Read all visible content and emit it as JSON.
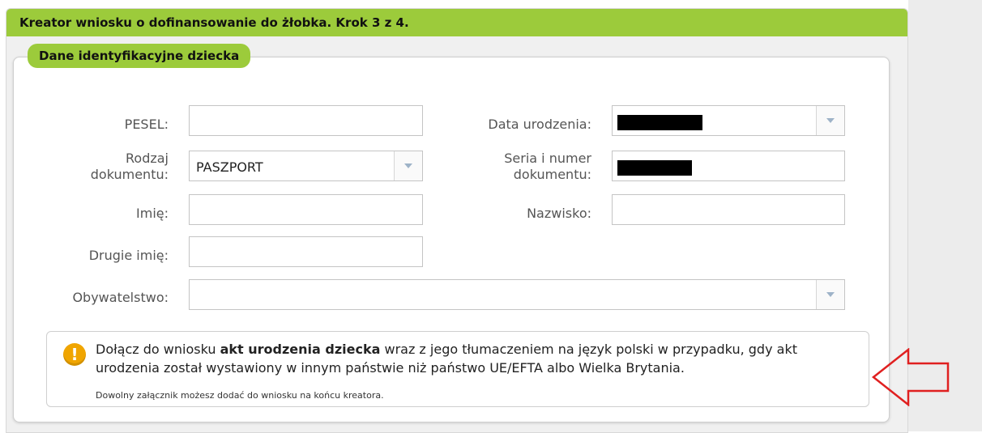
{
  "wizard": {
    "title": "Kreator wniosku o dofinansowanie do żłobka. Krok 3 z 4."
  },
  "section": {
    "legend": "Dane identyfikacyjne dziecka"
  },
  "form": {
    "pesel_label": "PESEL:",
    "pesel_value": "",
    "data_urodzenia_label": "Data urodzenia:",
    "rodzaj_label_line1": "Rodzaj",
    "rodzaj_label_line2": "dokumentu:",
    "rodzaj_value": "PASZPORT",
    "seria_label_line1": "Seria i numer",
    "seria_label_line2": "dokumentu:",
    "imie_label": "Imię:",
    "imie_value": "",
    "nazwisko_label": "Nazwisko:",
    "nazwisko_value": "",
    "drugie_imie_label": "Drugie imię:",
    "drugie_imie_value": "",
    "obywatelstwo_label": "Obywatelstwo:",
    "obywatelstwo_value": ""
  },
  "notice": {
    "icon": "exclamation-icon",
    "text_before": "Dołącz do wniosku ",
    "text_bold": "akt urodzenia dziecka",
    "text_after": " wraz z jego tłumaczeniem na język polski w przypadku, gdy akt urodzenia został wystawiony w innym państwie niż państwo UE/EFTA albo Wielka Brytania.",
    "small": "Dowolny załącznik możesz dodać do wniosku na końcu kreatora."
  },
  "colors": {
    "accent_green": "#9ccb3b",
    "warning_orange": "#f0a500",
    "annotation_red": "#e02020"
  }
}
